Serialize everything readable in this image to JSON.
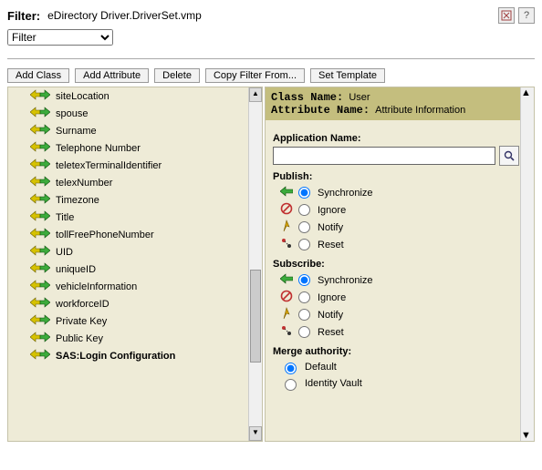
{
  "header": {
    "filter_label": "Filter:",
    "path": "eDirectory Driver.DriverSet.vmp",
    "dropdown_value": "Filter"
  },
  "toolbar": {
    "add_class": "Add Class",
    "add_attribute": "Add Attribute",
    "delete": "Delete",
    "copy_filter_from": "Copy Filter From...",
    "set_template": "Set Template"
  },
  "tree": {
    "items": [
      {
        "label": "siteLocation",
        "selected": false
      },
      {
        "label": "spouse",
        "selected": false
      },
      {
        "label": "Surname",
        "selected": false
      },
      {
        "label": "Telephone Number",
        "selected": false
      },
      {
        "label": "teletexTerminalIdentifier",
        "selected": false
      },
      {
        "label": "telexNumber",
        "selected": false
      },
      {
        "label": "Timezone",
        "selected": false
      },
      {
        "label": "Title",
        "selected": false
      },
      {
        "label": "tollFreePhoneNumber",
        "selected": false
      },
      {
        "label": "UID",
        "selected": false
      },
      {
        "label": "uniqueID",
        "selected": false
      },
      {
        "label": "vehicleInformation",
        "selected": false
      },
      {
        "label": "workforceID",
        "selected": false
      },
      {
        "label": "Private Key",
        "selected": false
      },
      {
        "label": "Public Key",
        "selected": false
      },
      {
        "label": "SAS:Login Configuration",
        "selected": true
      }
    ]
  },
  "detail": {
    "class_name_label": "Class Name:",
    "class_name_value": "User",
    "attr_name_label": "Attribute Name:",
    "attr_name_value": "Attribute Information",
    "app_name_label": "Application Name:",
    "app_name_value": "",
    "publish": {
      "label": "Publish:",
      "options": [
        "Synchronize",
        "Ignore",
        "Notify",
        "Reset"
      ],
      "selected": "Synchronize"
    },
    "subscribe": {
      "label": "Subscribe:",
      "options": [
        "Synchronize",
        "Ignore",
        "Notify",
        "Reset"
      ],
      "selected": "Synchronize"
    },
    "merge": {
      "label": "Merge authority:",
      "options": [
        "Default",
        "Identity Vault"
      ],
      "selected": "Default"
    }
  }
}
